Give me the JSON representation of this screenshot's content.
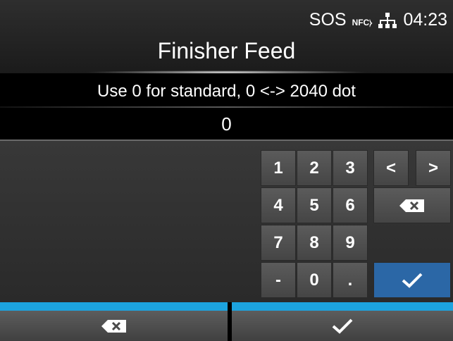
{
  "status": {
    "sos": "SOS",
    "nfc": "NFC",
    "time": "04:23"
  },
  "title": "Finisher Feed",
  "hint": "Use 0 for standard, 0 <-> 2040 dot",
  "value": "0",
  "keypad": {
    "k1": "1",
    "k2": "2",
    "k3": "3",
    "left": "<",
    "right": ">",
    "k4": "4",
    "k5": "5",
    "k6": "6",
    "k7": "7",
    "k8": "8",
    "k9": "9",
    "minus": "-",
    "k0": "0",
    "dot": "."
  },
  "colors": {
    "accent": "#1ca3df",
    "confirm": "#2b67a6"
  }
}
